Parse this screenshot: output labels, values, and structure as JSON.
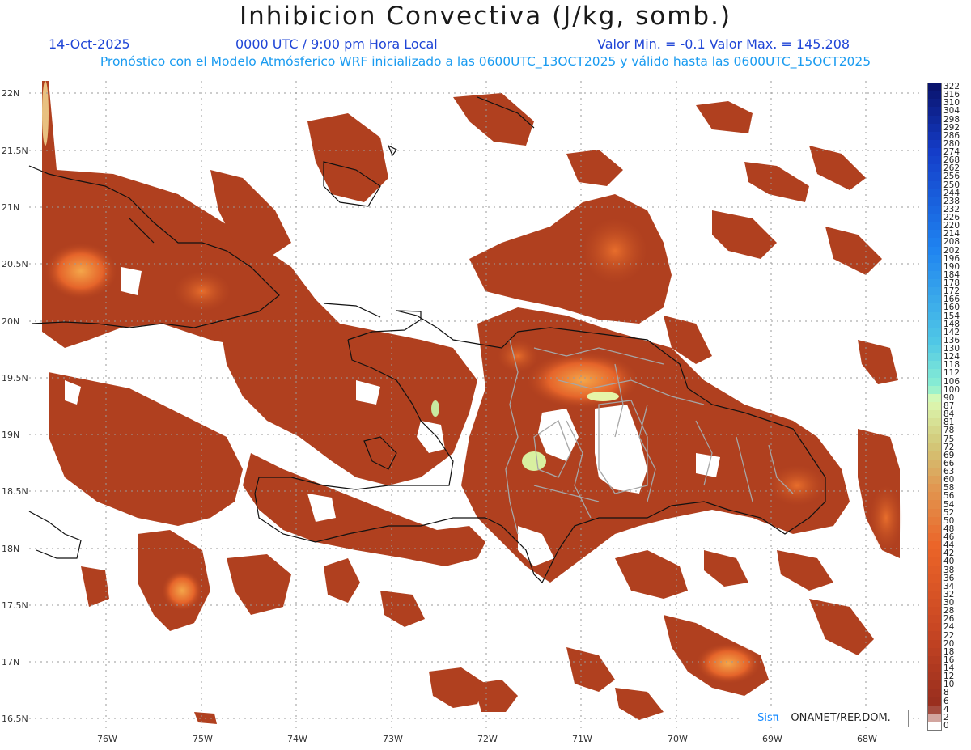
{
  "header": {
    "title": "Inhibicion Convectiva (J/kg, somb.)",
    "date": "14-Oct-2025",
    "time": "0000 UTC / 9:00 pm Hora Local",
    "minmax": "Valor Min. = -0.1  Valor Max. = 145.208",
    "description": "Pronóstico con el Modelo Atmósferico WRF inicializado a las 0600UTC_13OCT2025 y válido hasta las  0600UTC_15OCT2025"
  },
  "axes": {
    "lat_labels": [
      "22N",
      "21.5N",
      "21N",
      "20.5N",
      "20N",
      "19.5N",
      "19N",
      "18.5N",
      "18N",
      "17.5N",
      "17N",
      "16.5N"
    ],
    "lon_labels": [
      "76W",
      "75W",
      "74W",
      "73W",
      "72W",
      "71W",
      "70W",
      "69W",
      "68W"
    ]
  },
  "colorbar": {
    "labels": [
      "322",
      "316",
      "310",
      "304",
      "298",
      "292",
      "286",
      "280",
      "274",
      "268",
      "262",
      "256",
      "250",
      "244",
      "238",
      "232",
      "226",
      "220",
      "214",
      "208",
      "202",
      "196",
      "190",
      "184",
      "178",
      "172",
      "166",
      "160",
      "154",
      "148",
      "142",
      "136",
      "130",
      "124",
      "118",
      "112",
      "106",
      "100",
      "90",
      "87",
      "84",
      "81",
      "78",
      "75",
      "72",
      "69",
      "66",
      "63",
      "60",
      "58",
      "56",
      "54",
      "52",
      "50",
      "48",
      "46",
      "44",
      "42",
      "40",
      "38",
      "36",
      "34",
      "32",
      "30",
      "28",
      "26",
      "24",
      "22",
      "20",
      "18",
      "16",
      "14",
      "12",
      "10",
      "8",
      "6",
      "4",
      "2",
      "0"
    ]
  },
  "credit": {
    "brand": "Sisπ",
    "text": "– ONAMET/REP.DOM."
  }
}
